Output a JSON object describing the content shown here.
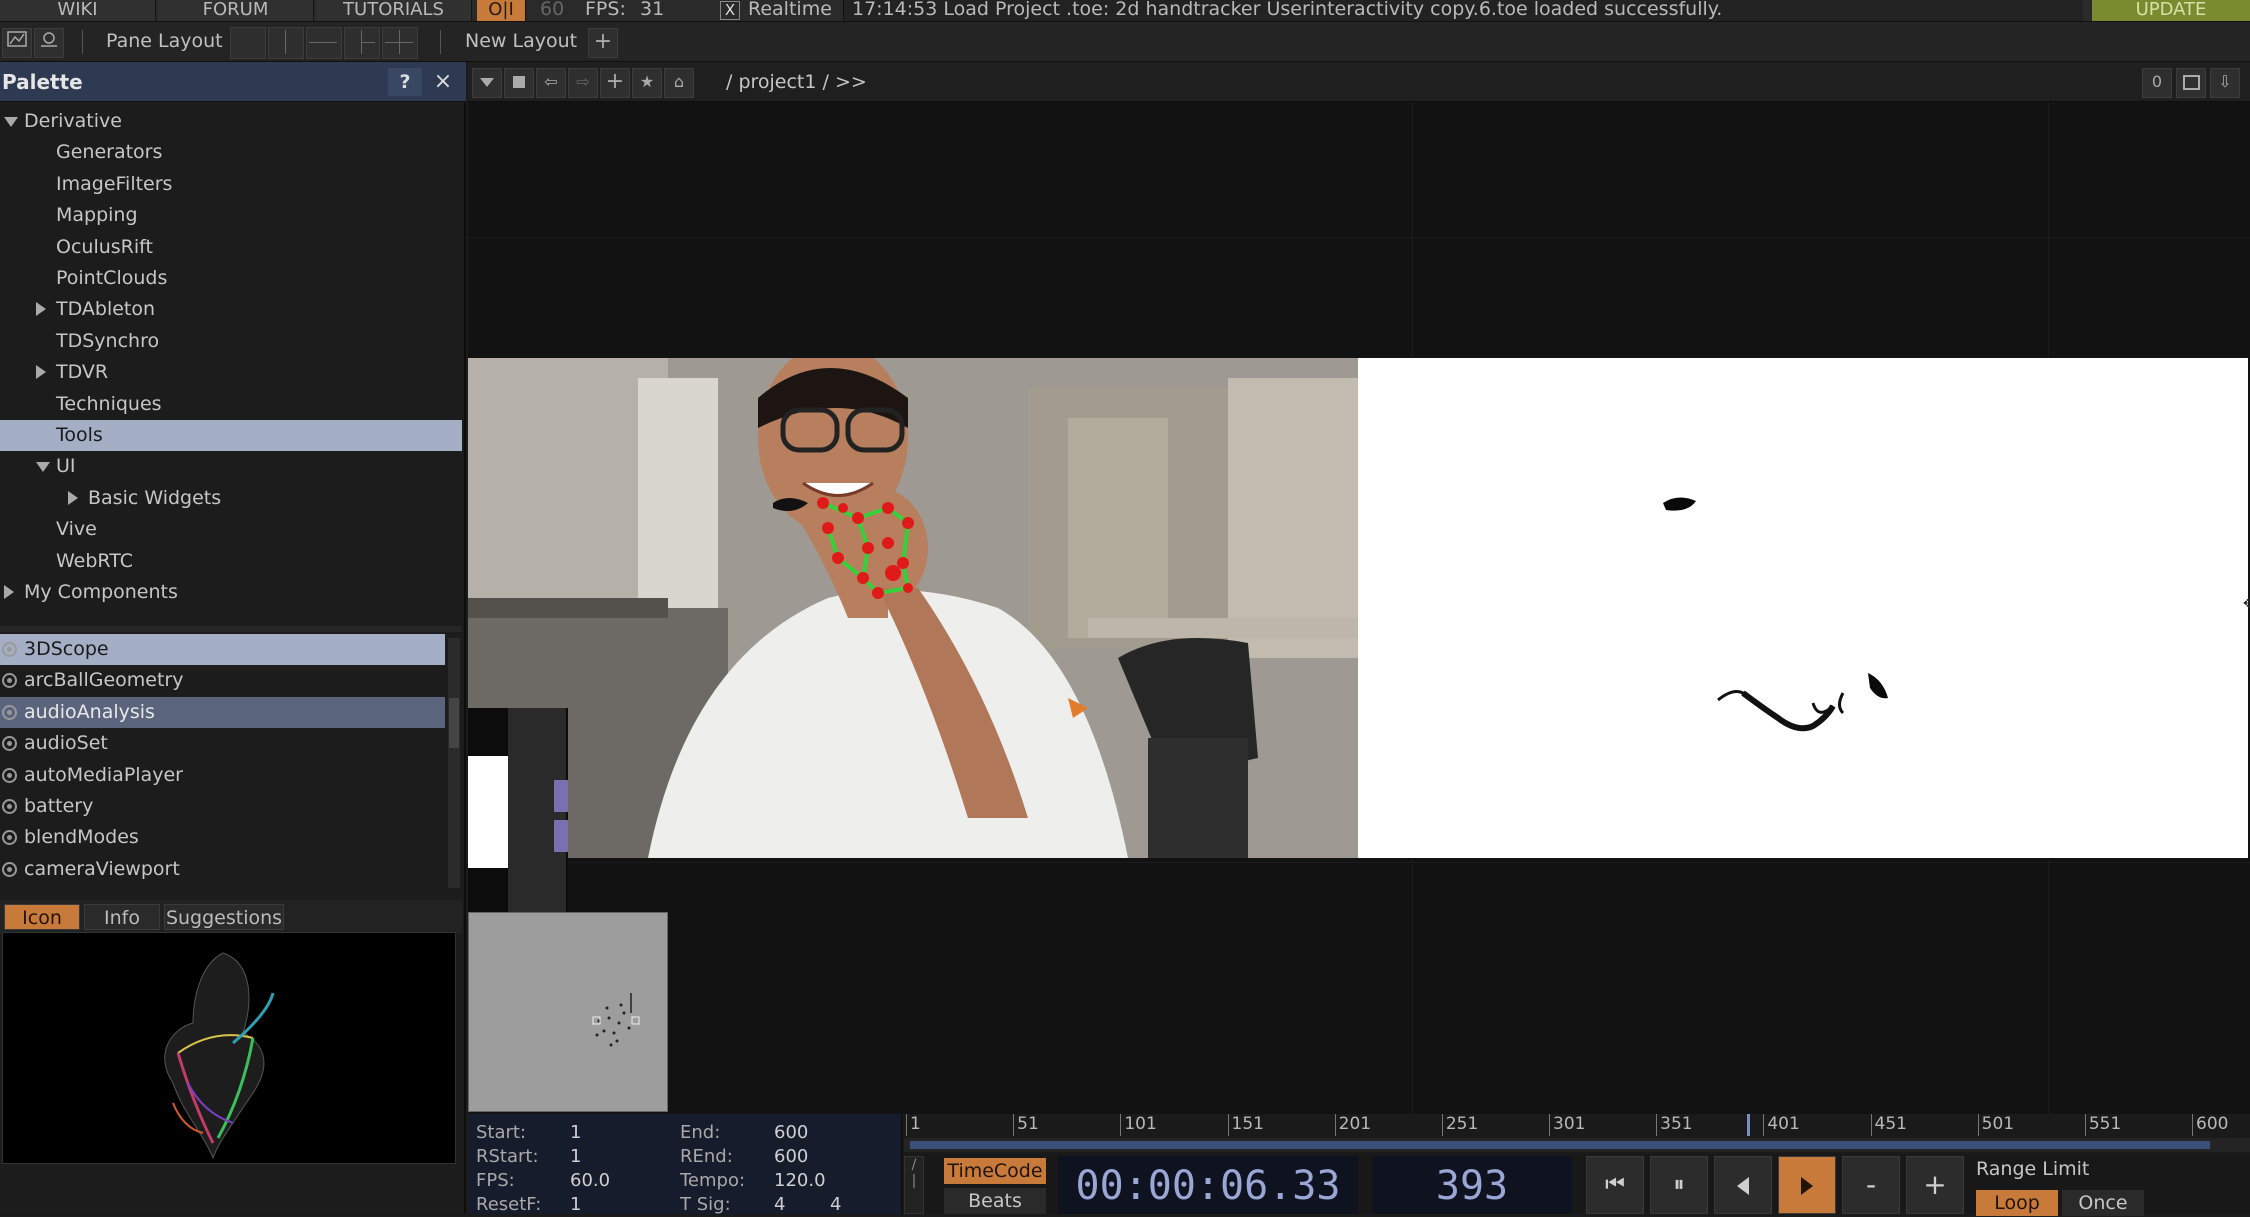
{
  "topbar": {
    "wiki": "WIKI",
    "forum": "FORUM",
    "tutorials": "TUTORIALS",
    "oi_badge": "O|I",
    "fps_target": "60",
    "fps_label": "FPS:",
    "fps_value": "31",
    "realtime_check": "X",
    "realtime_label": "Realtime",
    "status_message": "17:14:53 Load Project .toe: 2d handtracker Userinteractivity copy.6.toe loaded successfully.",
    "update_button": "UPDATE"
  },
  "bar2": {
    "pane_layout_label": "Pane Layout",
    "new_layout_label": "New Layout",
    "add_layout": "+"
  },
  "palette": {
    "title": "Palette",
    "help": "?",
    "close": "×",
    "tree": [
      {
        "label": "Derivative",
        "indent": 0,
        "expander": "down",
        "selected": false
      },
      {
        "label": "Generators",
        "indent": 2,
        "expander": "",
        "selected": false
      },
      {
        "label": "ImageFilters",
        "indent": 2,
        "expander": "",
        "selected": false
      },
      {
        "label": "Mapping",
        "indent": 2,
        "expander": "",
        "selected": false
      },
      {
        "label": "OculusRift",
        "indent": 2,
        "expander": "",
        "selected": false
      },
      {
        "label": "PointClouds",
        "indent": 2,
        "expander": "",
        "selected": false
      },
      {
        "label": "TDAbleton",
        "indent": 1,
        "expander": "right",
        "selected": false
      },
      {
        "label": "TDSynchro",
        "indent": 2,
        "expander": "",
        "selected": false
      },
      {
        "label": "TDVR",
        "indent": 1,
        "expander": "right",
        "selected": false
      },
      {
        "label": "Techniques",
        "indent": 2,
        "expander": "",
        "selected": false
      },
      {
        "label": "Tools",
        "indent": 2,
        "expander": "",
        "selected": true
      },
      {
        "label": "UI",
        "indent": 1,
        "expander": "down",
        "selected": false
      },
      {
        "label": "Basic Widgets",
        "indent": 3,
        "expander": "right",
        "selected": false
      },
      {
        "label": "Vive",
        "indent": 2,
        "expander": "",
        "selected": false
      },
      {
        "label": "WebRTC",
        "indent": 2,
        "expander": "",
        "selected": false
      },
      {
        "label": "My Components",
        "indent": 0,
        "expander": "right",
        "selected": false
      }
    ],
    "components": [
      {
        "label": "3DScope",
        "state": "sel2"
      },
      {
        "label": "arcBallGeometry",
        "state": ""
      },
      {
        "label": "audioAnalysis",
        "state": "sel"
      },
      {
        "label": "audioSet",
        "state": ""
      },
      {
        "label": "autoMediaPlayer",
        "state": ""
      },
      {
        "label": "battery",
        "state": ""
      },
      {
        "label": "blendModes",
        "state": ""
      },
      {
        "label": "cameraViewport",
        "state": ""
      }
    ],
    "tabs": {
      "icon": "Icon",
      "info": "Info",
      "suggestions": "Suggestions"
    }
  },
  "network": {
    "path": "/ project1 / >>",
    "counter": "0"
  },
  "timeline": {
    "start_label": "Start:",
    "start_value": "1",
    "rstart_label": "RStart:",
    "rstart_value": "1",
    "fps_label": "FPS:",
    "fps_value": "60.0",
    "resetf_label": "ResetF:",
    "resetf_value": "1",
    "end_label": "End:",
    "end_value": "600",
    "rend_label": "REnd:",
    "rend_value": "600",
    "tempo_label": "Tempo:",
    "tempo_value": "120.0",
    "tsig_label": "T Sig:",
    "tsig_value_a": "4",
    "tsig_value_b": "4",
    "ruler_ticks": [
      "1",
      "51",
      "101",
      "151",
      "201",
      "251",
      "301",
      "351",
      "401",
      "451",
      "501",
      "551",
      "600"
    ],
    "timecode_button": "TimeCode",
    "beats_button": "Beats",
    "timecode": "00:00:06.33",
    "frame": "393",
    "minus": "-",
    "plus": "+",
    "range_limit_label": "Range Limit",
    "loop_button": "Loop",
    "once_button": "Once",
    "playhead_fraction": 0.654
  },
  "colors": {
    "accent_orange": "#c77a3a",
    "palette_header": "#2d3a52",
    "selection": "#a4afc6",
    "update_green": "#7a8a2e",
    "hand_line": "#36d13a",
    "hand_point": "#e01919"
  }
}
